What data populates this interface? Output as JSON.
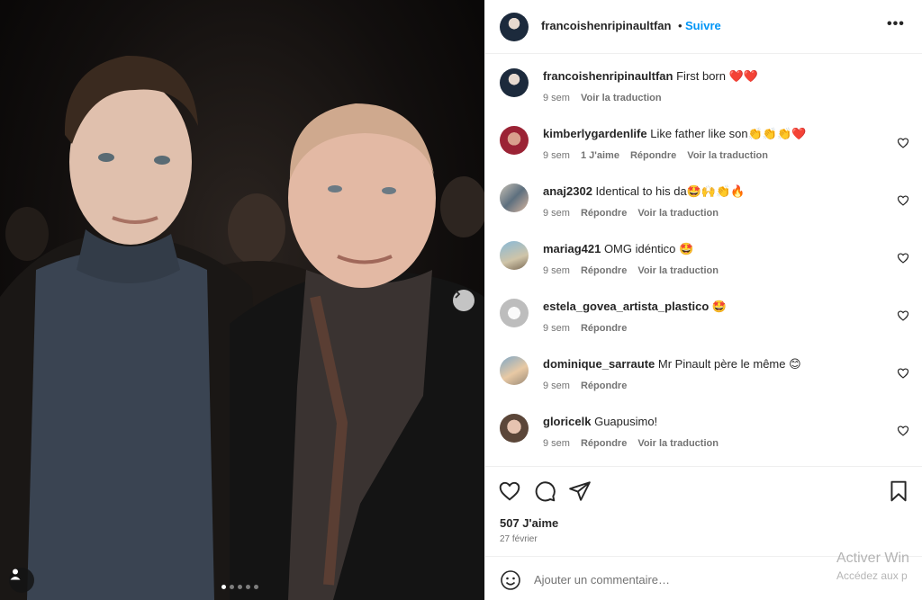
{
  "post": {
    "author": "francoishenripinaultfan",
    "separator": "•",
    "follow_label": "Suivre",
    "more_icon": "more-horizontal-icon",
    "carousel_dots": 5,
    "active_dot": 1
  },
  "comments": [
    {
      "user": "francoishenripinaultfan",
      "text": "First born ❤️❤️",
      "time": "9 sem",
      "likes": "",
      "reply": "",
      "translate": "Voir la traduction",
      "has_heart": false
    },
    {
      "user": "kimberlygardenlife",
      "text": "Like father like son👏👏👏❤️",
      "time": "9 sem",
      "likes": "1 J'aime",
      "reply": "Répondre",
      "translate": "Voir la traduction",
      "has_heart": true
    },
    {
      "user": "anaj2302",
      "text": "Identical to his da🤩🙌👏🔥",
      "time": "9 sem",
      "likes": "",
      "reply": "Répondre",
      "translate": "Voir la traduction",
      "has_heart": true
    },
    {
      "user": "mariag421",
      "text": "OMG idéntico 🤩",
      "time": "9 sem",
      "likes": "",
      "reply": "Répondre",
      "translate": "Voir la traduction",
      "has_heart": true
    },
    {
      "user": "estela_govea_artista_plastico",
      "text": "🤩",
      "time": "9 sem",
      "likes": "",
      "reply": "Répondre",
      "translate": "",
      "has_heart": true
    },
    {
      "user": "dominique_sarraute",
      "text": "Mr Pinault père le même 😊",
      "time": "9 sem",
      "likes": "",
      "reply": "Répondre",
      "translate": "",
      "has_heart": true
    },
    {
      "user": "gloricelk",
      "text": "Guapusimo!",
      "time": "9 sem",
      "likes": "",
      "reply": "Répondre",
      "translate": "Voir la traduction",
      "has_heart": true
    }
  ],
  "actions": {
    "likes_count": "507 J'aime",
    "date": "27 février"
  },
  "composer": {
    "placeholder": "Ajouter un commentaire…"
  },
  "watermark": {
    "line1": "Activer Win",
    "line2": "Accédez aux p"
  },
  "colors": {
    "follow": "#0095f6",
    "text": "#262626",
    "secondary": "#737373",
    "divider": "#efefef"
  }
}
